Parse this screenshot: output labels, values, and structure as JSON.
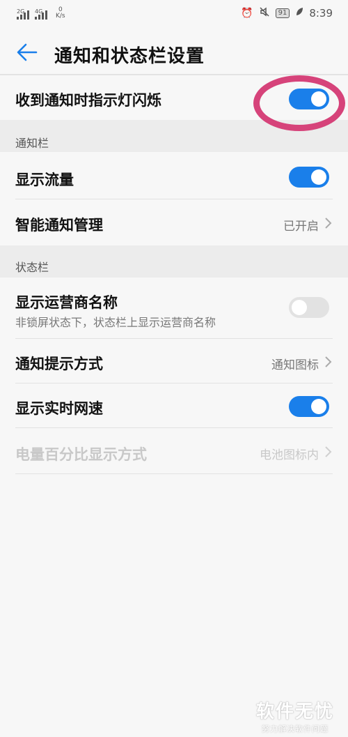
{
  "status_bar": {
    "signal1_label": "2G",
    "signal2_label": "4G",
    "speed_value": "0",
    "speed_unit": "K/s",
    "battery": "91",
    "time": "8:39"
  },
  "header": {
    "title": "通知和状态栏设置"
  },
  "rows": {
    "indicator": {
      "label": "收到通知时指示灯闪烁",
      "toggle": "on"
    },
    "show_traffic": {
      "label": "显示流量",
      "toggle": "on"
    },
    "smart_notify": {
      "label": "智能通知管理",
      "value": "已开启"
    },
    "carrier_name": {
      "label": "显示运营商名称",
      "sub": "非锁屏状态下，状态栏上显示运营商名称",
      "toggle": "off"
    },
    "notify_style": {
      "label": "通知提示方式",
      "value": "通知图标"
    },
    "realtime_speed": {
      "label": "显示实时网速",
      "toggle": "on"
    },
    "battery_percent": {
      "label": "电量百分比显示方式",
      "value": "电池图标内"
    }
  },
  "sections": {
    "notification_bar": "通知栏",
    "status_bar": "状态栏"
  },
  "colors": {
    "accent": "#1a7fea",
    "annotation": "#d6437a"
  },
  "watermark": {
    "main": "软件无忧",
    "sub": "努力解决软件问题"
  }
}
